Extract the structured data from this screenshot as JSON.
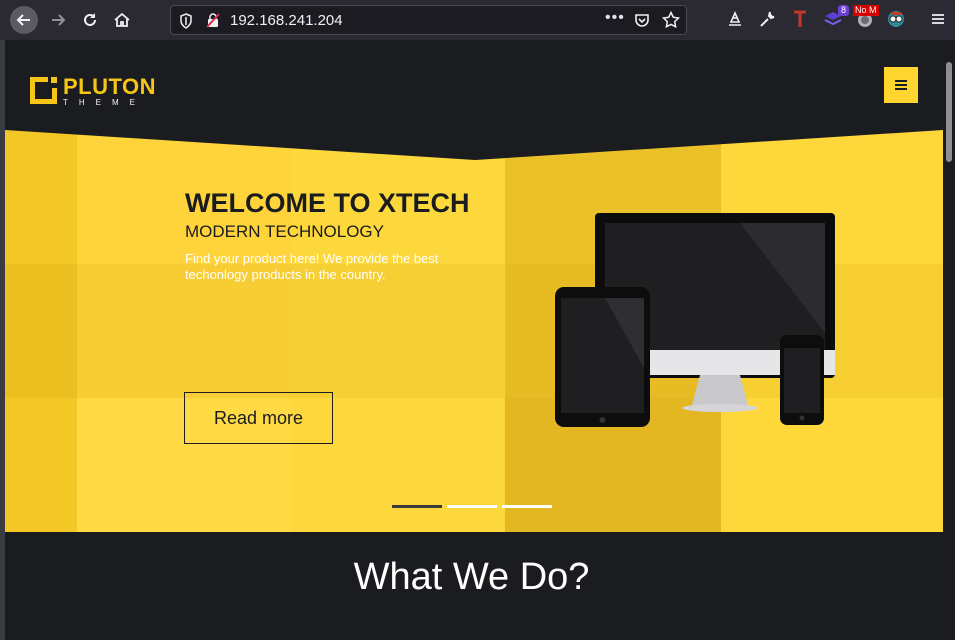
{
  "browser": {
    "url": "192.168.241.204",
    "page_actions_label": "•••",
    "extensions": [
      {
        "name": "container-icon"
      },
      {
        "name": "wrench-icon"
      },
      {
        "name": "t-extension-icon",
        "glyph": "T"
      },
      {
        "name": "layers-extension-icon",
        "badge": "8"
      },
      {
        "name": "noscript-icon",
        "badge": "No M"
      },
      {
        "name": "glasses-avatar-icon"
      }
    ]
  },
  "site": {
    "logo_title": "PLUTON",
    "logo_subtitle": "THEME",
    "hero": {
      "title": "WELCOME TO XTECH",
      "subtitle": "MODERN TECHNOLOGY",
      "text": "Find your product here! We provide the best techonlogy products in the country.",
      "button": "Read more"
    },
    "slider_active_index": 0,
    "section_title": "What We Do?"
  },
  "colors": {
    "accent": "#ffd43b",
    "dark": "#1b1c1f"
  }
}
